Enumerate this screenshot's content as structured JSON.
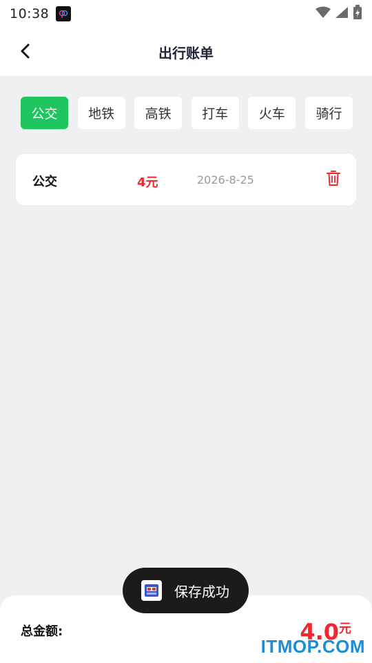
{
  "status_bar": {
    "time": "10:38",
    "icons": [
      "app-notification-icon",
      "wifi-icon",
      "signal-icon",
      "battery-icon"
    ]
  },
  "header": {
    "title": "出行账单",
    "back_icon": "chevron-left-icon"
  },
  "tabs": [
    {
      "label": "公交",
      "active": true
    },
    {
      "label": "地铁",
      "active": false
    },
    {
      "label": "高铁",
      "active": false
    },
    {
      "label": "打车",
      "active": false
    },
    {
      "label": "火车",
      "active": false
    },
    {
      "label": "骑行",
      "active": false
    }
  ],
  "bills": [
    {
      "category": "公交",
      "amount": "4元",
      "date": "2026-8-25",
      "delete_icon": "trash-icon"
    }
  ],
  "toast": {
    "text": "保存成功",
    "icon": "app-icon"
  },
  "footer": {
    "total_label": "总金额:",
    "total_value": "4.0",
    "total_unit": "元"
  },
  "watermark": "ITMOP.COM",
  "colors": {
    "accent_green": "#1fc660",
    "amount_red": "#f2262f",
    "background": "#eef0f1",
    "title_dark": "#1e2533"
  }
}
